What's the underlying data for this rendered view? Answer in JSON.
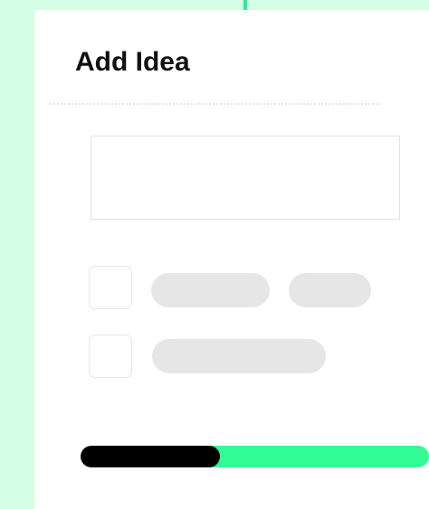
{
  "dialog": {
    "title": "Add Idea",
    "idea_input": {
      "value": "",
      "placeholder": ""
    },
    "options": [
      {
        "checked": false,
        "text_placeholders": 2
      },
      {
        "checked": false,
        "text_placeholders": 1
      }
    ],
    "progress": {
      "fraction": 0.4
    }
  },
  "colors": {
    "background_mint": "#d4fde5",
    "accent_green": "#33fc97",
    "progress_fill": "#000000",
    "placeholder_gray": "#e6e6e6"
  }
}
